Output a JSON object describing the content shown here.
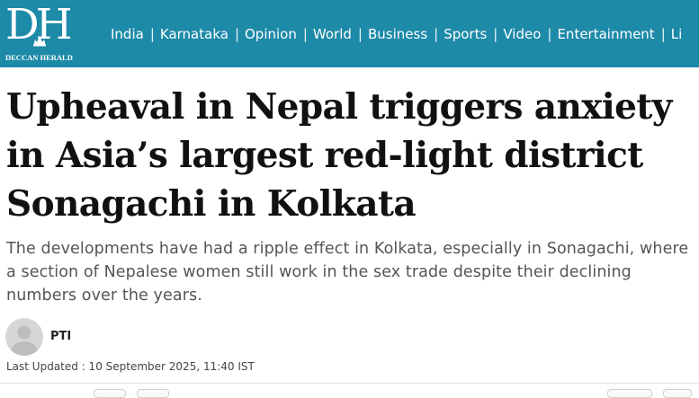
{
  "brand": {
    "mark": "DH",
    "name": "DECCAN HERALD",
    "color": "#1d8aa8"
  },
  "nav": {
    "items": [
      {
        "label": "India"
      },
      {
        "label": "Karnataka"
      },
      {
        "label": "Opinion"
      },
      {
        "label": "World"
      },
      {
        "label": "Business"
      },
      {
        "label": "Sports"
      },
      {
        "label": "Video"
      },
      {
        "label": "Entertainment"
      },
      {
        "label": "Li"
      }
    ],
    "separator": "|"
  },
  "article": {
    "headline": "Upheaval in Nepal triggers anxiety in Asia’s largest red-light district Sonagachi in Kolkata",
    "summary": "The developments have had a ripple effect in Kolkata, especially in Sonagachi, where a section of Nepalese women still work in the sex trade despite their declining numbers over the years.",
    "author": "PTI",
    "avatar_icon": "user-avatar-icon",
    "last_updated": "Last Updated : 10 September 2025, 11:40 IST"
  }
}
